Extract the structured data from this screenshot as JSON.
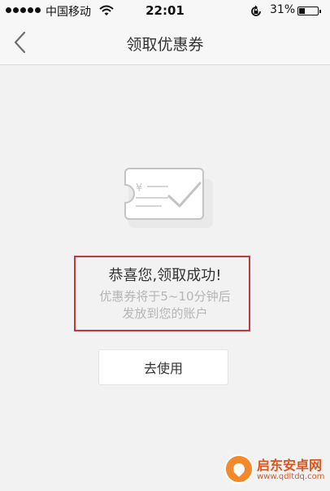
{
  "status_bar": {
    "carrier": "中国移动",
    "time": "22:01",
    "battery": "31%",
    "battery_level": 0.31
  },
  "nav": {
    "title": "领取优惠券",
    "back_icon": "chevron-left-icon"
  },
  "illustration": {
    "icon": "coupon-check-icon",
    "symbol": "¥"
  },
  "result": {
    "title": "恭喜您,领取成功!",
    "desc_line1": "优惠券将于5~10分钟后",
    "desc_line2": "发放到您的账户",
    "highlight_color": "#c0393b"
  },
  "actions": {
    "use_label": "去使用"
  },
  "watermark": {
    "name": "启东安卓网",
    "url": "www.qdltdq.com"
  }
}
